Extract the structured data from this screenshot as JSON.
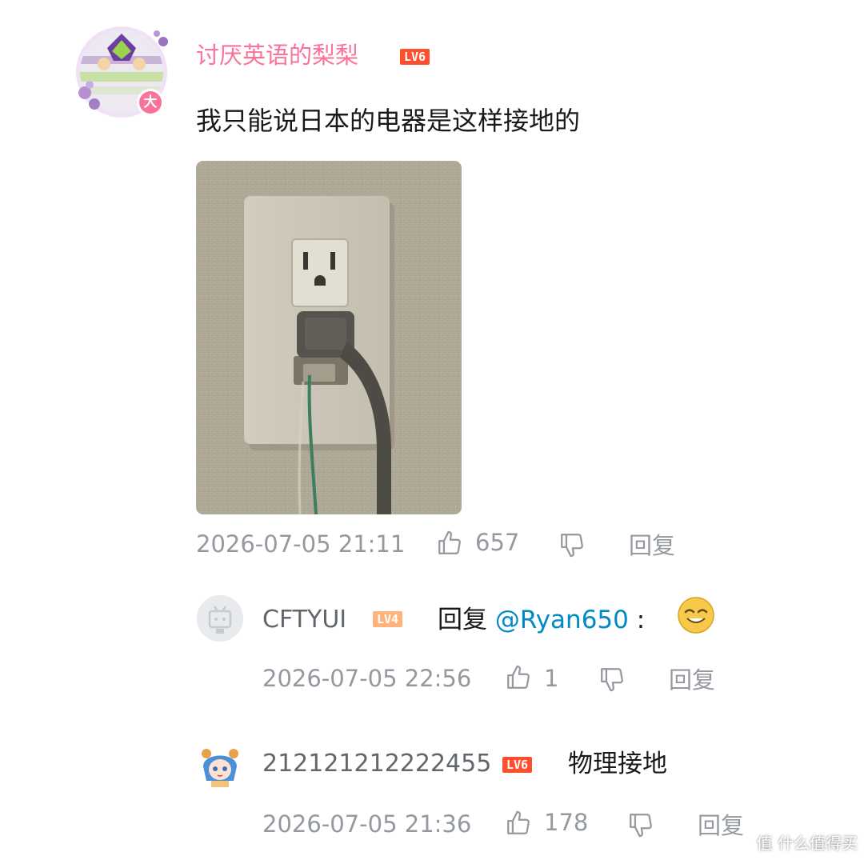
{
  "main_comment": {
    "username": "讨厌英语的梨梨",
    "level": "LV6",
    "avatar_badge": "大",
    "content": "我只能说日本的电器是这样接地的",
    "timestamp": "2026-07-05 21:11",
    "likes": "657",
    "reply_label": "回复"
  },
  "replies": [
    {
      "username": "CFTYUI",
      "level": "LV4",
      "reply_prefix": "回复",
      "mention": "@Ryan650",
      "separator": ":",
      "emoji": "smirk-emoji",
      "timestamp": "2026-07-05 22:56",
      "likes": "1",
      "reply_label": "回复"
    },
    {
      "username": "212121212222455",
      "level": "LV6",
      "content": "物理接地",
      "timestamp": "2026-07-05 21:36",
      "likes": "178",
      "reply_label": "回复"
    }
  ],
  "watermark": "值 什么值得买",
  "colors": {
    "username_pink": "#fb7299",
    "meta_gray": "#9499a0",
    "link_blue": "#008ac5",
    "lv6": "#ff4e2d",
    "lv4": "#ffb27a"
  }
}
